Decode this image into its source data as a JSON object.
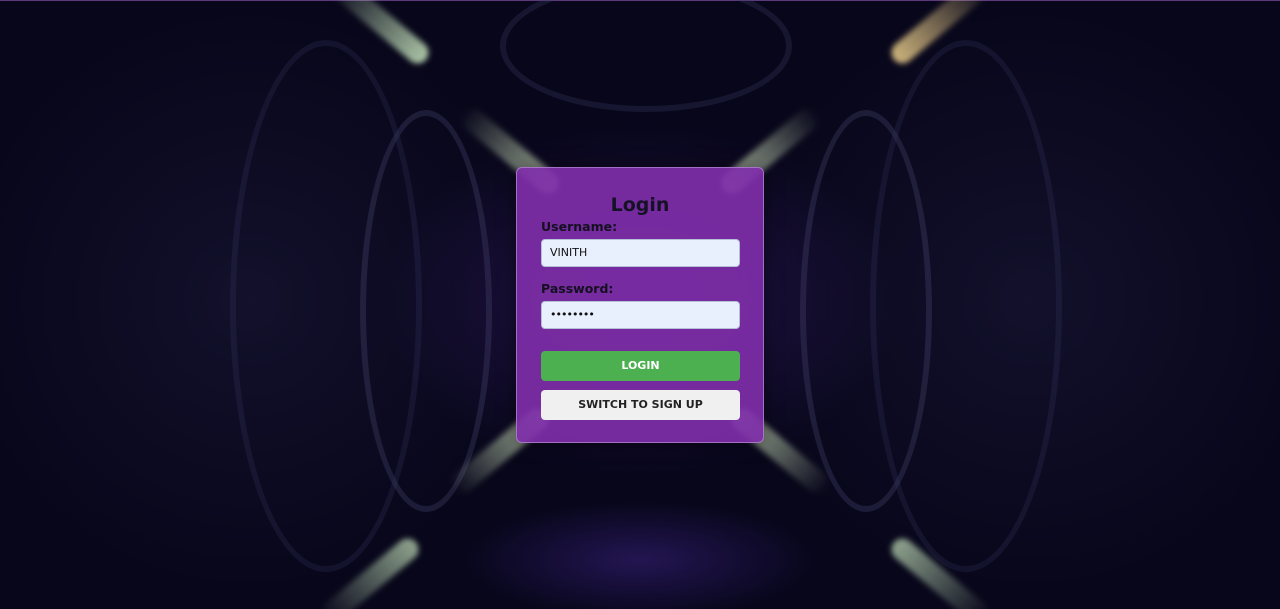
{
  "form": {
    "title": "Login",
    "username_label": "Username:",
    "username_value": "VINITH",
    "password_label": "Password:",
    "password_value": "••••••••",
    "login_button": "LOGIN",
    "switch_button": "SWITCH TO SIGN UP"
  },
  "colors": {
    "card": "#7e2ea8",
    "login_button": "#4caf50",
    "switch_button": "#f0f0f0",
    "input_background": "#e8effd"
  }
}
